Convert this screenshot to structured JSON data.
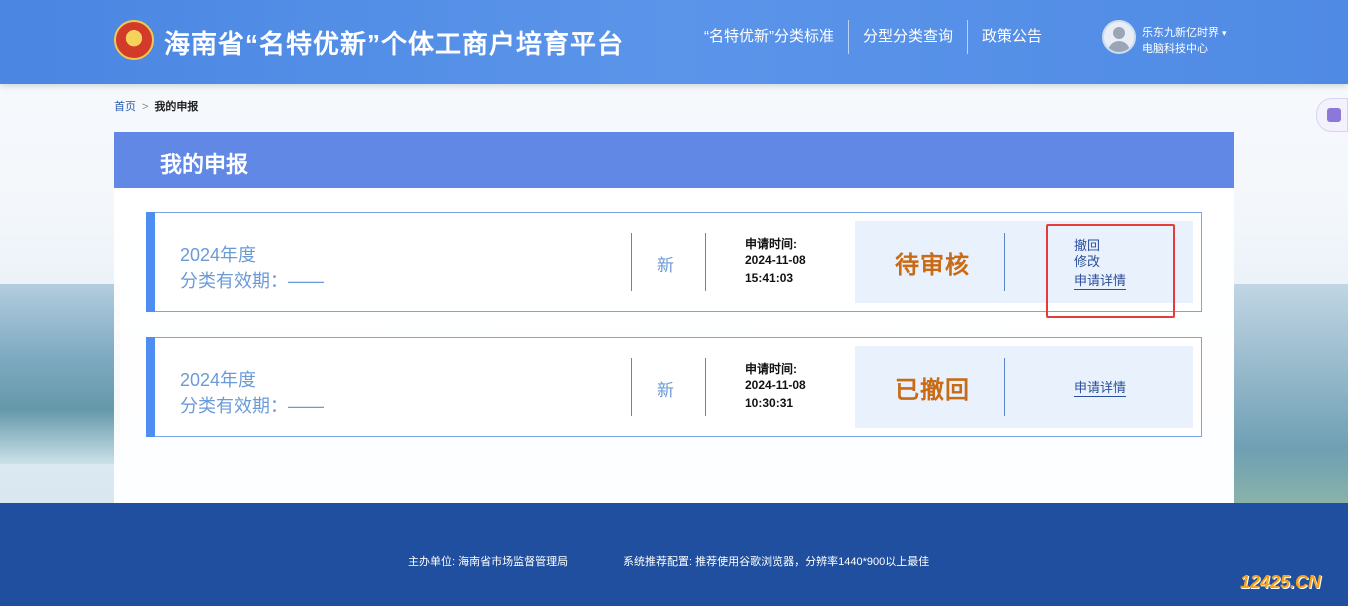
{
  "header": {
    "site_title": "海南省“名特优新”个体工商户培育平台",
    "nav": [
      "“名特优新”分类标准",
      "分型分类查询",
      "政策公告"
    ],
    "user": {
      "name": "乐东九新亿时界",
      "org": "电脑科技中心",
      "caret": "▾"
    }
  },
  "breadcrumb": {
    "home": "首页",
    "sep": ">",
    "current": "我的申报"
  },
  "panel": {
    "title": "我的申报"
  },
  "records": [
    {
      "year": "2024年度",
      "validity": "分类有效期：——",
      "type": "新",
      "time_label": "申请时间:",
      "date": "2024-11-08",
      "clock": "15:41:03",
      "status": "待审核",
      "actions": [
        "撤回",
        "修改",
        "申请详情"
      ]
    },
    {
      "year": "2024年度",
      "validity": "分类有效期：——",
      "type": "新",
      "time_label": "申请时间:",
      "date": "2024-11-08",
      "clock": "10:30:31",
      "status": "已撤回",
      "actions": [
        "申请详情"
      ]
    }
  ],
  "footer": {
    "host": "主办单位:  海南省市场监督管理局",
    "config": "系统推荐配置:  推荐使用谷歌浏览器，分辨率1440*900以上最佳"
  },
  "watermark": "12425.CN",
  "colors": {
    "header": "#4a86e2",
    "panel_head": "#6288e6",
    "status": "#c96a14",
    "footer": "#1f4f9e",
    "highlight": "#e53b3b"
  }
}
